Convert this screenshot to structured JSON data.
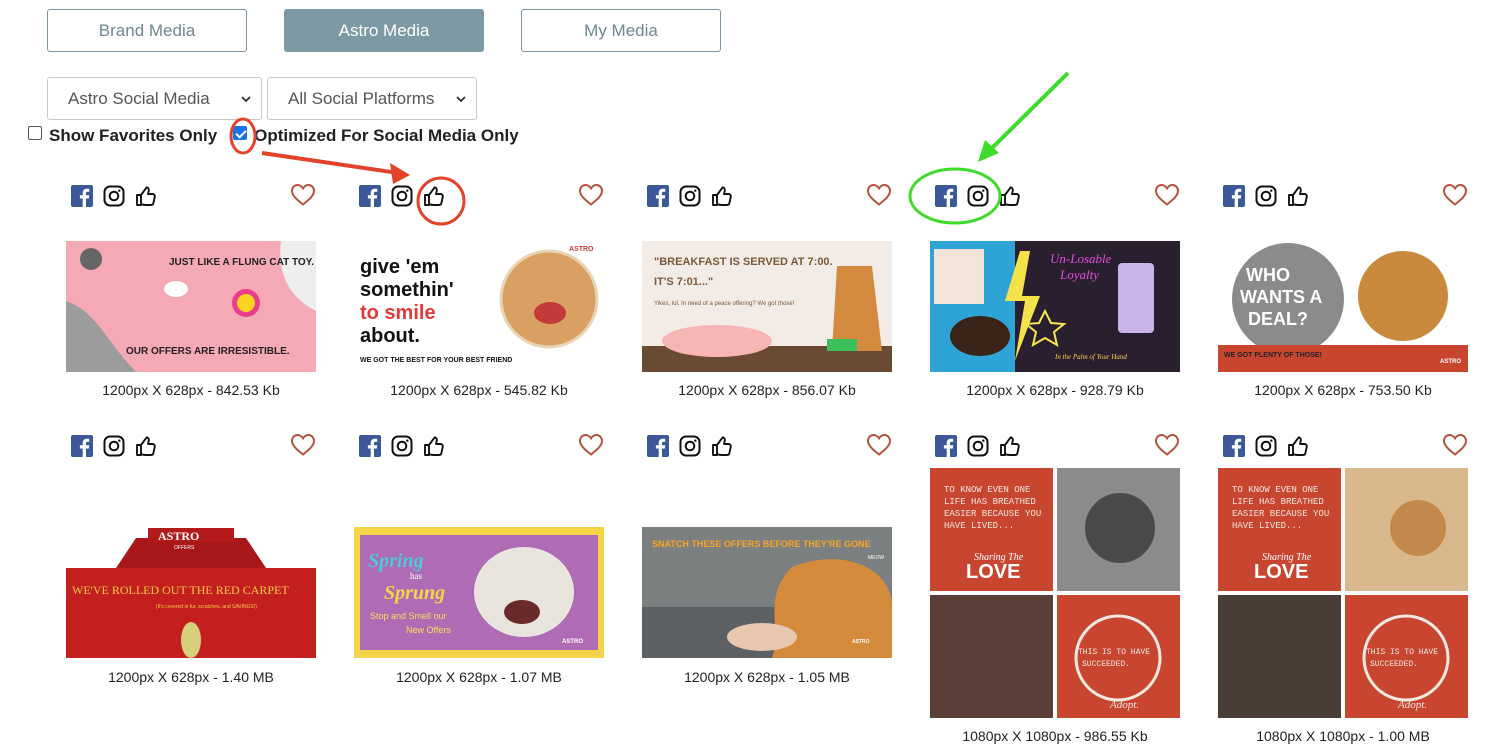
{
  "tabs": [
    {
      "label": "Brand Media",
      "active": false
    },
    {
      "label": "Astro Media",
      "active": true
    },
    {
      "label": "My Media",
      "active": false
    }
  ],
  "filters": {
    "category": {
      "selected": "Astro Social Media"
    },
    "platform": {
      "selected": "All Social Platforms"
    }
  },
  "checkboxes": {
    "favorites": {
      "label": "Show Favorites Only",
      "checked": false
    },
    "optimized": {
      "label": "Optimized For Social Media Only",
      "checked": true
    }
  },
  "media": [
    {
      "caption": "1200px X 628px - 842.53 Kb",
      "thumb_texts": [
        "JUST LIKE A FLUNG CAT TOY.",
        "OUR OFFERS ARE IRRESISTIBLE."
      ]
    },
    {
      "caption": "1200px X 628px - 545.82 Kb",
      "thumb_texts": [
        "give 'em",
        "somethin'",
        "to smile",
        "about.",
        "WE GOT THE BEST FOR YOUR BEST FRIEND",
        "ASTRO"
      ]
    },
    {
      "caption": "1200px X 628px - 856.07 Kb",
      "thumb_texts": [
        "\"BREAKFAST IS SERVED AT 7:00.",
        "IT'S 7:01...\"",
        "Yikes, lol. In need of a peace offering? We got those!"
      ]
    },
    {
      "caption": "1200px X 628px - 928.79 Kb",
      "thumb_texts": [
        "Un-Losable",
        "Loyalty",
        "In the Palm of Your Hand"
      ]
    },
    {
      "caption": "1200px X 628px - 753.50 Kb",
      "thumb_texts": [
        "WHO",
        "WANTS A",
        "DEAL?",
        "WE GOT PLENTY OF THOSE!",
        "ASTRO"
      ]
    },
    {
      "caption": "1200px X 628px - 1.40 MB",
      "thumb_texts": [
        "ASTRO",
        "OFFERS",
        "WE'VE ROLLED OUT THE RED CARPET",
        "(It's covered in fur, scratches, and SAVINGS!)"
      ]
    },
    {
      "caption": "1200px X 628px - 1.07 MB",
      "thumb_texts": [
        "Spring",
        "has",
        "Sprung",
        "Stop and Smell our",
        "New Offers",
        "ASTRO"
      ]
    },
    {
      "caption": "1200px X 628px - 1.05 MB",
      "thumb_texts": [
        "SNATCH THESE OFFERS BEFORE THEY'RE GONE",
        "MEOW",
        "ASTRO"
      ]
    },
    {
      "caption": "1080px X 1080px - 986.55 Kb",
      "thumb_texts": [
        "TO KNOW EVEN ONE",
        "LIFE HAS BREATHED",
        "EASIER BECAUSE YOU",
        "HAVE LIVED...",
        "Sharing The",
        "LOVE",
        "THIS IS TO HAVE",
        "SUCCEEDED.",
        "Adopt."
      ]
    },
    {
      "caption": "1080px X 1080px - 1.00 MB",
      "thumb_texts": [
        "TO KNOW EVEN ONE",
        "LIFE HAS BREATHED",
        "EASIER BECAUSE YOU",
        "HAVE LIVED...",
        "Sharing The",
        "LOVE",
        "THIS IS TO HAVE",
        "SUCCEEDED.",
        "Adopt."
      ]
    }
  ],
  "colors": {
    "tab_active_bg": "#7d99a3",
    "tab_border": "#7a96a1",
    "facebook": "#3b5998",
    "heart": "#b5523f",
    "annotation_red": "#e1442a",
    "annotation_green": "#3ddc2b"
  },
  "icons": [
    "facebook-icon",
    "instagram-icon",
    "thumbs-up-icon",
    "heart-icon",
    "chevron-down-icon"
  ]
}
